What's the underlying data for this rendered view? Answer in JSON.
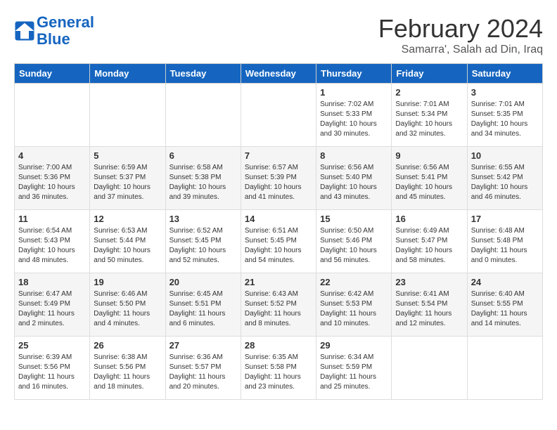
{
  "header": {
    "logo_line1": "General",
    "logo_line2": "Blue",
    "month": "February 2024",
    "location": "Samarra', Salah ad Din, Iraq"
  },
  "days_of_week": [
    "Sunday",
    "Monday",
    "Tuesday",
    "Wednesday",
    "Thursday",
    "Friday",
    "Saturday"
  ],
  "weeks": [
    [
      {
        "day": "",
        "info": ""
      },
      {
        "day": "",
        "info": ""
      },
      {
        "day": "",
        "info": ""
      },
      {
        "day": "",
        "info": ""
      },
      {
        "day": "1",
        "info": "Sunrise: 7:02 AM\nSunset: 5:33 PM\nDaylight: 10 hours\nand 30 minutes."
      },
      {
        "day": "2",
        "info": "Sunrise: 7:01 AM\nSunset: 5:34 PM\nDaylight: 10 hours\nand 32 minutes."
      },
      {
        "day": "3",
        "info": "Sunrise: 7:01 AM\nSunset: 5:35 PM\nDaylight: 10 hours\nand 34 minutes."
      }
    ],
    [
      {
        "day": "4",
        "info": "Sunrise: 7:00 AM\nSunset: 5:36 PM\nDaylight: 10 hours\nand 36 minutes."
      },
      {
        "day": "5",
        "info": "Sunrise: 6:59 AM\nSunset: 5:37 PM\nDaylight: 10 hours\nand 37 minutes."
      },
      {
        "day": "6",
        "info": "Sunrise: 6:58 AM\nSunset: 5:38 PM\nDaylight: 10 hours\nand 39 minutes."
      },
      {
        "day": "7",
        "info": "Sunrise: 6:57 AM\nSunset: 5:39 PM\nDaylight: 10 hours\nand 41 minutes."
      },
      {
        "day": "8",
        "info": "Sunrise: 6:56 AM\nSunset: 5:40 PM\nDaylight: 10 hours\nand 43 minutes."
      },
      {
        "day": "9",
        "info": "Sunrise: 6:56 AM\nSunset: 5:41 PM\nDaylight: 10 hours\nand 45 minutes."
      },
      {
        "day": "10",
        "info": "Sunrise: 6:55 AM\nSunset: 5:42 PM\nDaylight: 10 hours\nand 46 minutes."
      }
    ],
    [
      {
        "day": "11",
        "info": "Sunrise: 6:54 AM\nSunset: 5:43 PM\nDaylight: 10 hours\nand 48 minutes."
      },
      {
        "day": "12",
        "info": "Sunrise: 6:53 AM\nSunset: 5:44 PM\nDaylight: 10 hours\nand 50 minutes."
      },
      {
        "day": "13",
        "info": "Sunrise: 6:52 AM\nSunset: 5:45 PM\nDaylight: 10 hours\nand 52 minutes."
      },
      {
        "day": "14",
        "info": "Sunrise: 6:51 AM\nSunset: 5:45 PM\nDaylight: 10 hours\nand 54 minutes."
      },
      {
        "day": "15",
        "info": "Sunrise: 6:50 AM\nSunset: 5:46 PM\nDaylight: 10 hours\nand 56 minutes."
      },
      {
        "day": "16",
        "info": "Sunrise: 6:49 AM\nSunset: 5:47 PM\nDaylight: 10 hours\nand 58 minutes."
      },
      {
        "day": "17",
        "info": "Sunrise: 6:48 AM\nSunset: 5:48 PM\nDaylight: 11 hours\nand 0 minutes."
      }
    ],
    [
      {
        "day": "18",
        "info": "Sunrise: 6:47 AM\nSunset: 5:49 PM\nDaylight: 11 hours\nand 2 minutes."
      },
      {
        "day": "19",
        "info": "Sunrise: 6:46 AM\nSunset: 5:50 PM\nDaylight: 11 hours\nand 4 minutes."
      },
      {
        "day": "20",
        "info": "Sunrise: 6:45 AM\nSunset: 5:51 PM\nDaylight: 11 hours\nand 6 minutes."
      },
      {
        "day": "21",
        "info": "Sunrise: 6:43 AM\nSunset: 5:52 PM\nDaylight: 11 hours\nand 8 minutes."
      },
      {
        "day": "22",
        "info": "Sunrise: 6:42 AM\nSunset: 5:53 PM\nDaylight: 11 hours\nand 10 minutes."
      },
      {
        "day": "23",
        "info": "Sunrise: 6:41 AM\nSunset: 5:54 PM\nDaylight: 11 hours\nand 12 minutes."
      },
      {
        "day": "24",
        "info": "Sunrise: 6:40 AM\nSunset: 5:55 PM\nDaylight: 11 hours\nand 14 minutes."
      }
    ],
    [
      {
        "day": "25",
        "info": "Sunrise: 6:39 AM\nSunset: 5:56 PM\nDaylight: 11 hours\nand 16 minutes."
      },
      {
        "day": "26",
        "info": "Sunrise: 6:38 AM\nSunset: 5:56 PM\nDaylight: 11 hours\nand 18 minutes."
      },
      {
        "day": "27",
        "info": "Sunrise: 6:36 AM\nSunset: 5:57 PM\nDaylight: 11 hours\nand 20 minutes."
      },
      {
        "day": "28",
        "info": "Sunrise: 6:35 AM\nSunset: 5:58 PM\nDaylight: 11 hours\nand 23 minutes."
      },
      {
        "day": "29",
        "info": "Sunrise: 6:34 AM\nSunset: 5:59 PM\nDaylight: 11 hours\nand 25 minutes."
      },
      {
        "day": "",
        "info": ""
      },
      {
        "day": "",
        "info": ""
      }
    ]
  ]
}
